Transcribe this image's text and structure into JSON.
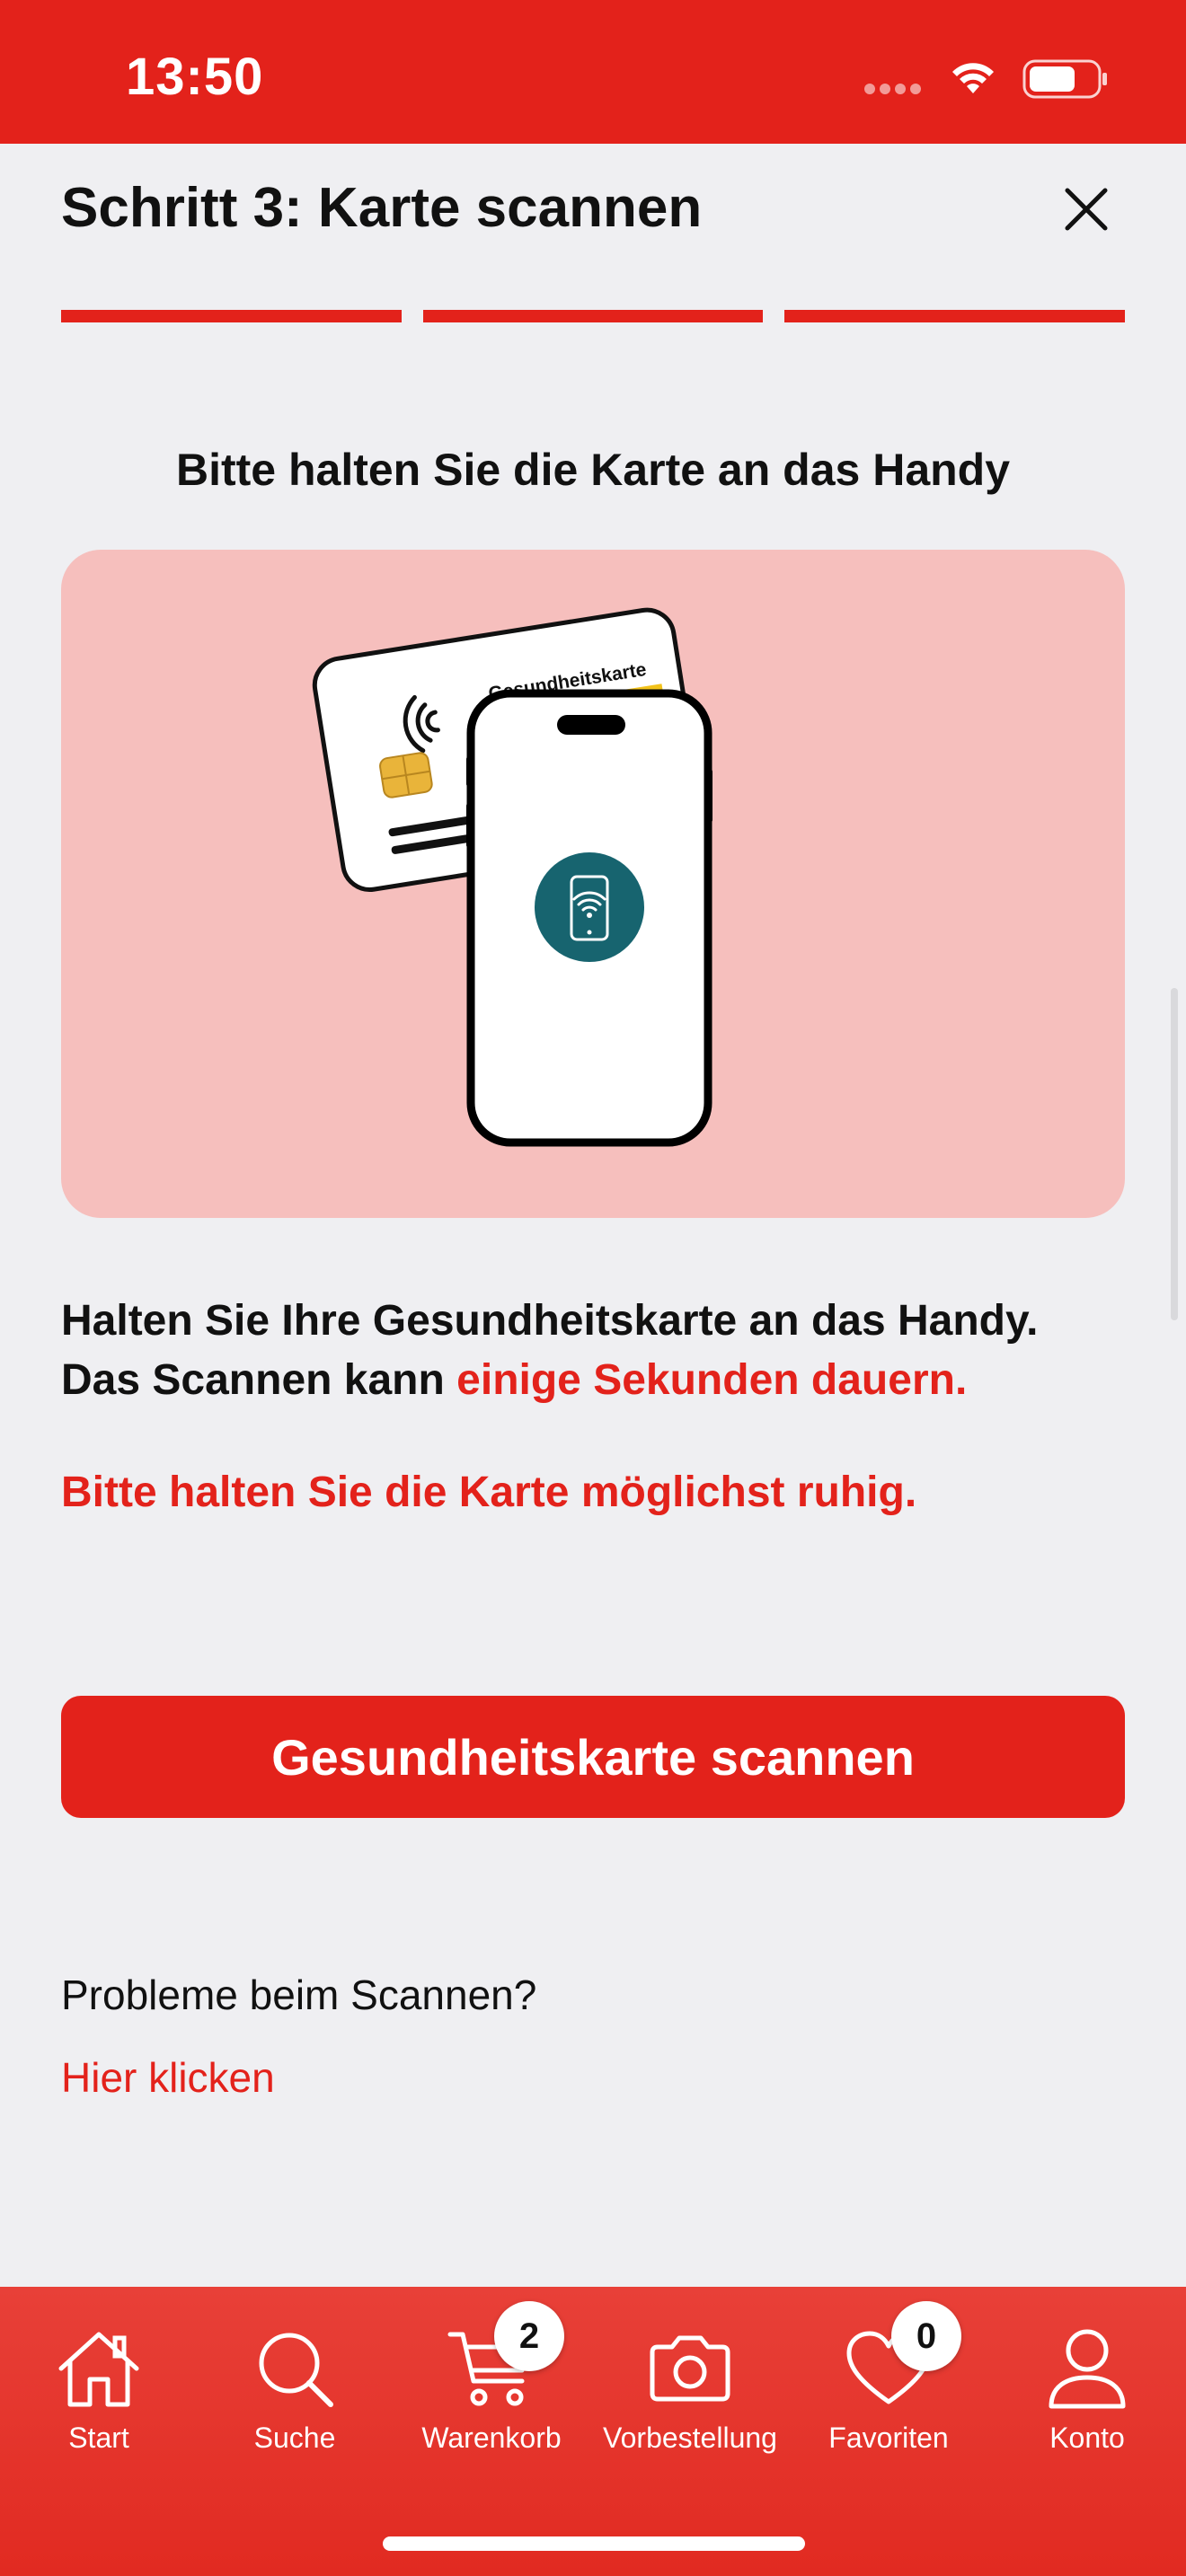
{
  "status_bar": {
    "time": "13:50"
  },
  "header": {
    "title": "Schritt 3: Karte scannen",
    "steps_total": 3,
    "steps_completed": 3
  },
  "instruction": {
    "heading": "Bitte halten Sie die Karte an das Handy"
  },
  "illustration": {
    "card_label": "Gesundheitskarte"
  },
  "body": {
    "line1": "Halten Sie Ihre Gesundheitskarte an das Handy.",
    "line2_prefix": "Das Scannen kann ",
    "line2_highlight": "einige Sekunden dauern.",
    "warning": "Bitte halten Sie die Karte möglichst ruhig."
  },
  "scan_button": {
    "label": "Gesundheitskarte scannen"
  },
  "help": {
    "question": "Probleme beim Scannen?",
    "link": "Hier klicken"
  },
  "tab_bar": {
    "items": [
      {
        "label": "Start",
        "icon": "home-icon"
      },
      {
        "label": "Suche",
        "icon": "search-icon"
      },
      {
        "label": "Warenkorb",
        "icon": "cart-icon",
        "badge": "2"
      },
      {
        "label": "Vorbestellung",
        "icon": "camera-icon"
      },
      {
        "label": "Favoriten",
        "icon": "heart-icon",
        "badge": "0"
      },
      {
        "label": "Konto",
        "icon": "user-icon"
      }
    ]
  },
  "colors": {
    "accent": "#e3221b",
    "background": "#efeff2",
    "illustration_bg": "#f6bfbd",
    "nfc_circle": "#17646f"
  }
}
